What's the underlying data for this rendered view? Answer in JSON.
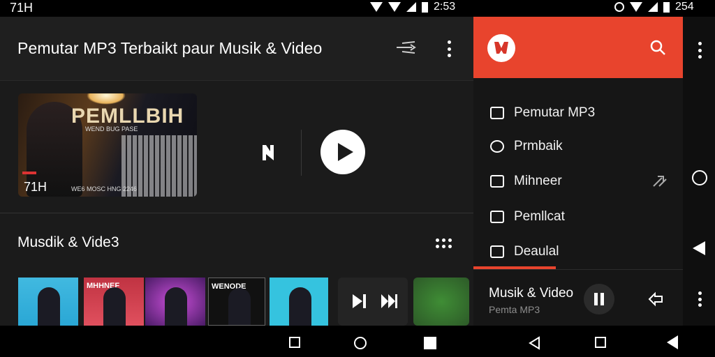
{
  "status_bar": {
    "left_time": "71H",
    "middle_time": "2:53",
    "right_time": "254"
  },
  "app": {
    "title": "Pemutar MP3 Terbaikt paur Musik & Video"
  },
  "player_card": {
    "thumb_title": "PEMLLBIH",
    "thumb_subtitle": "WEND BUG PASE",
    "thumb_duration": "71H",
    "thumb_bottom_text": "WE6 MOSC HNG 2246"
  },
  "section": {
    "title": "Musdik & Vide3"
  },
  "thumbnails": [
    {
      "label": "",
      "color": "#3cb6de"
    },
    {
      "label": "MHHNEF",
      "color": "#cf3f4d"
    },
    {
      "label": "",
      "color": "#8a3aa6"
    },
    {
      "label": "WENODE",
      "color": "#111111"
    },
    {
      "label": "",
      "color": "#35c3df"
    }
  ],
  "drawer": {
    "header_color": "#e8442d",
    "items": [
      {
        "label": "Pemutar MP3",
        "icon": "music-note-icon"
      },
      {
        "label": "Prmbaik",
        "icon": "history-icon"
      },
      {
        "label": "Mihneer",
        "icon": "edit-icon"
      },
      {
        "label": "Pemllcat",
        "icon": "share-box-icon"
      },
      {
        "label": "Deaulal",
        "icon": "video-icon"
      }
    ],
    "now_playing_title": "Musik & Video",
    "now_playing_subtitle": "Pemta MP3"
  }
}
